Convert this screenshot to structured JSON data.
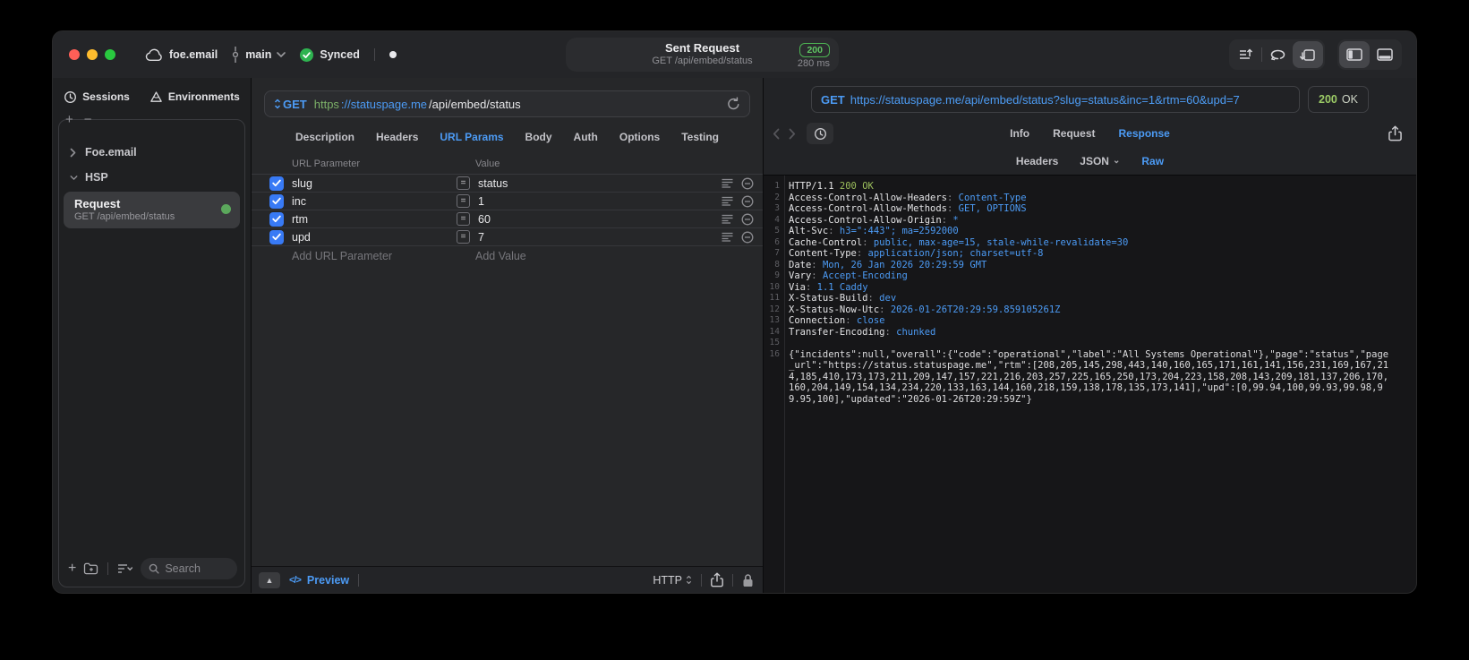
{
  "titlebar": {
    "project": "foe.email",
    "branch": "main",
    "sync_status": "Synced",
    "request_title": "Sent Request",
    "request_subtitle": "GET /api/embed/status",
    "status_code": "200",
    "duration": "280 ms"
  },
  "sidebar": {
    "tabs": [
      "Sessions",
      "Environments"
    ],
    "tree": [
      {
        "label": "Foe.email",
        "expanded": false
      },
      {
        "label": "HSP",
        "expanded": true
      }
    ],
    "selected_request": {
      "title": "Request",
      "subtitle": "GET /api/embed/status"
    },
    "search_placeholder": "Search"
  },
  "request_panel": {
    "method": "GET",
    "url_scheme": "https",
    "url_host": "://statuspage.me",
    "url_path": "/api/embed/status",
    "tabs": [
      "Description",
      "Headers",
      "URL Params",
      "Body",
      "Auth",
      "Options",
      "Testing"
    ],
    "active_tab": "URL Params",
    "table": {
      "columns": [
        "URL Parameter",
        "Value"
      ],
      "rows": [
        {
          "name": "slug",
          "value": "status",
          "enabled": true
        },
        {
          "name": "inc",
          "value": "1",
          "enabled": true
        },
        {
          "name": "rtm",
          "value": "60",
          "enabled": true
        },
        {
          "name": "upd",
          "value": "7",
          "enabled": true
        }
      ],
      "add_row": {
        "name_placeholder": "Add URL Parameter",
        "value_placeholder": "Add Value"
      }
    },
    "footer": {
      "preview_label": "Preview",
      "protocol": "HTTP"
    }
  },
  "response_panel": {
    "method": "GET",
    "url": "https://statuspage.me/api/embed/status?slug=status&inc=1&rtm=60&upd=7",
    "status_code": "200",
    "status_text": "OK",
    "tabs": [
      "Info",
      "Request",
      "Response"
    ],
    "active_tab": "Response",
    "subtabs": [
      {
        "label": "Headers"
      },
      {
        "label": "JSON",
        "has_chevron": true
      },
      {
        "label": "Raw"
      }
    ],
    "active_subtab": "Raw",
    "raw": {
      "status_line": {
        "protocol": "HTTP/1.1",
        "status": "200 OK"
      },
      "headers": [
        {
          "name": "Access-Control-Allow-Headers",
          "value": "Content-Type"
        },
        {
          "name": "Access-Control-Allow-Methods",
          "value": "GET, OPTIONS"
        },
        {
          "name": "Access-Control-Allow-Origin",
          "value": "*"
        },
        {
          "name": "Alt-Svc",
          "value": "h3=\":443\"; ma=2592000"
        },
        {
          "name": "Cache-Control",
          "value": "public, max-age=15, stale-while-revalidate=30"
        },
        {
          "name": "Content-Type",
          "value": "application/json; charset=utf-8"
        },
        {
          "name": "Date",
          "value": "Mon, 26 Jan 2026 20:29:59 GMT"
        },
        {
          "name": "Vary",
          "value": "Accept-Encoding"
        },
        {
          "name": "Via",
          "value": "1.1 Caddy"
        },
        {
          "name": "X-Status-Build",
          "value": "dev"
        },
        {
          "name": "X-Status-Now-Utc",
          "value": "2026-01-26T20:29:59.859105261Z"
        },
        {
          "name": "Connection",
          "value": "close"
        },
        {
          "name": "Transfer-Encoding",
          "value": "chunked"
        }
      ],
      "body": "{\"incidents\":null,\"overall\":{\"code\":\"operational\",\"label\":\"All Systems Operational\"},\"page\":\"status\",\"page_url\":\"https://status.statuspage.me\",\"rtm\":[208,205,145,298,443,140,160,165,171,161,141,156,231,169,167,214,185,410,173,173,211,209,147,157,221,216,203,257,225,165,250,173,204,223,158,208,143,209,181,137,206,170,160,204,149,154,134,234,220,133,163,144,160,218,159,138,178,135,173,141],\"upd\":[0,99.94,100,99.93,99.98,99.95,100],\"updated\":\"2026-01-26T20:29:59Z\"}"
    }
  }
}
